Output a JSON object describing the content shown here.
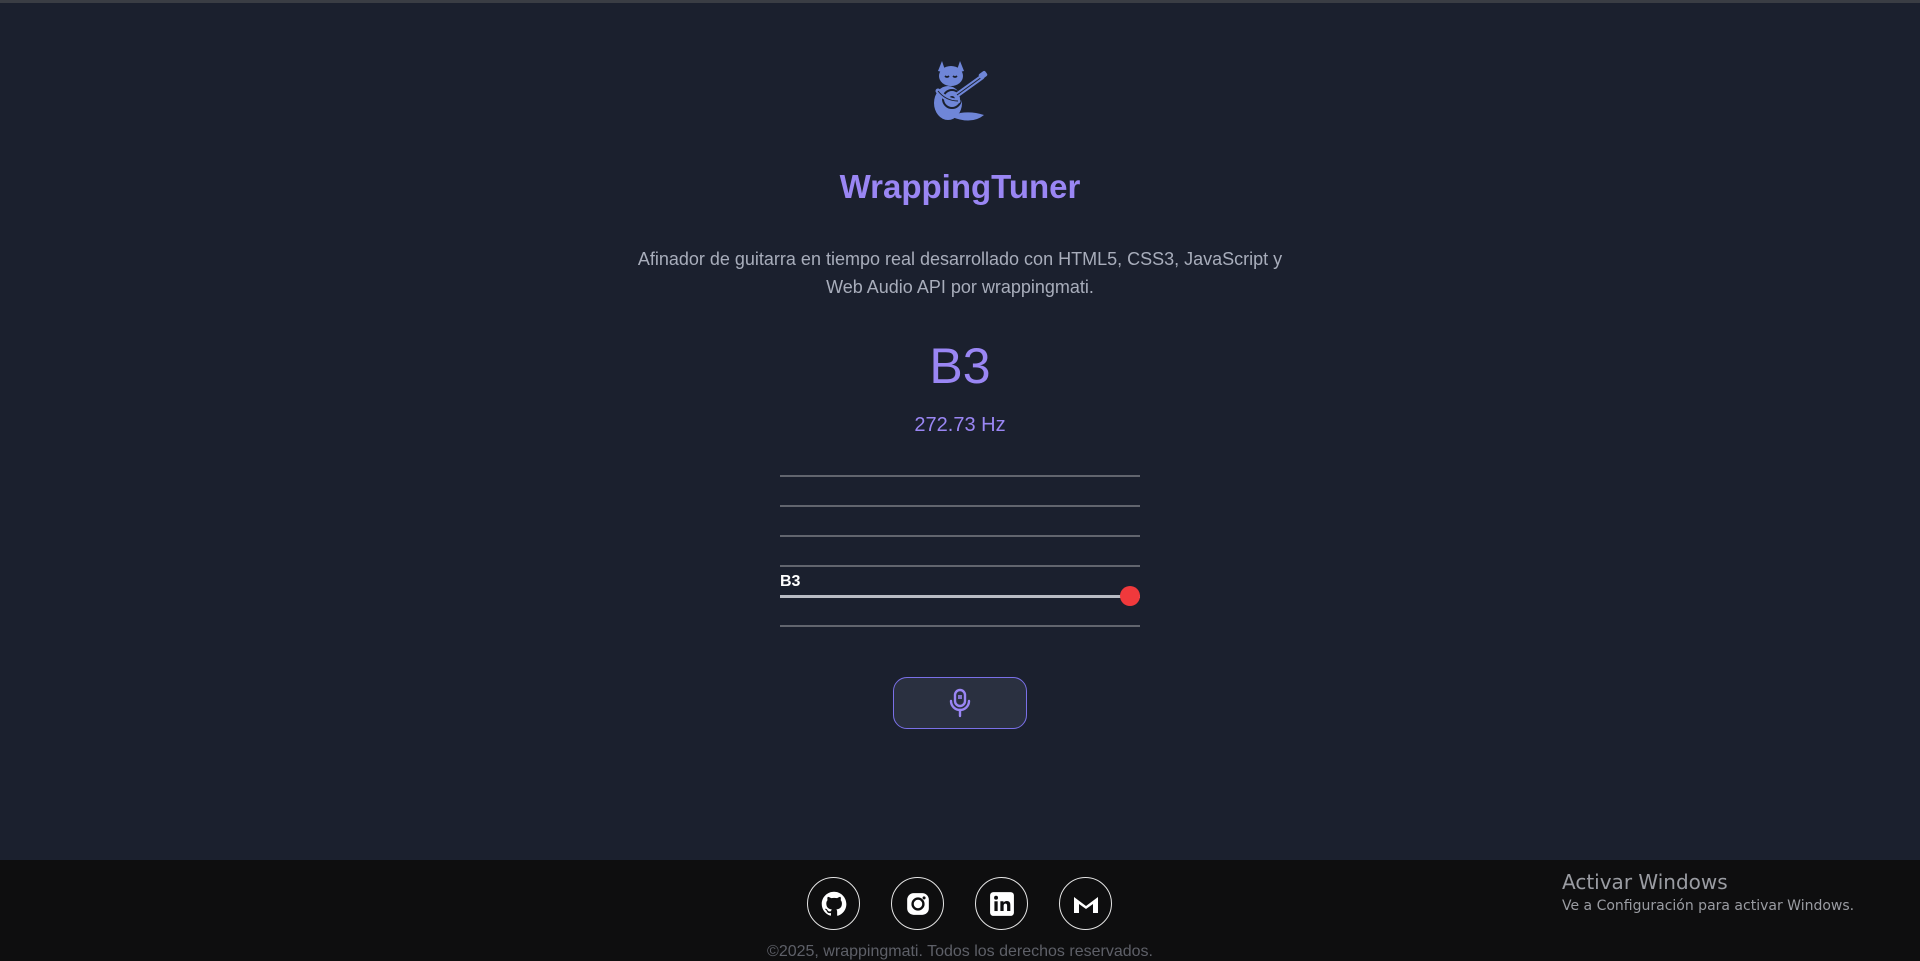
{
  "app": {
    "title": "WrappingTuner",
    "description": "Afinador de guitarra en tiempo real desarrollado con HTML5, CSS3, JavaScript y Web Audio API por wrappingmati."
  },
  "tuner": {
    "note": "B3",
    "frequency": "272.73 Hz",
    "active_string_label": "B3",
    "indicator_position": 1.0
  },
  "icons": {
    "logo": "fox-guitar-logo-icon",
    "mic": "microphone-icon",
    "github": "github-icon",
    "instagram": "instagram-icon",
    "linkedin": "linkedin-icon",
    "gmail": "gmail-icon"
  },
  "colors": {
    "accent": "#9a86f4",
    "indicator": "#f0393c",
    "background": "#1b202e",
    "footer": "#0e0e0f"
  },
  "footer": {
    "copyright": "©2025, wrappingmati. Todos los derechos reservados."
  },
  "os_overlay": {
    "title": "Activar Windows",
    "subtitle": "Ve a Configuración para activar Windows."
  }
}
